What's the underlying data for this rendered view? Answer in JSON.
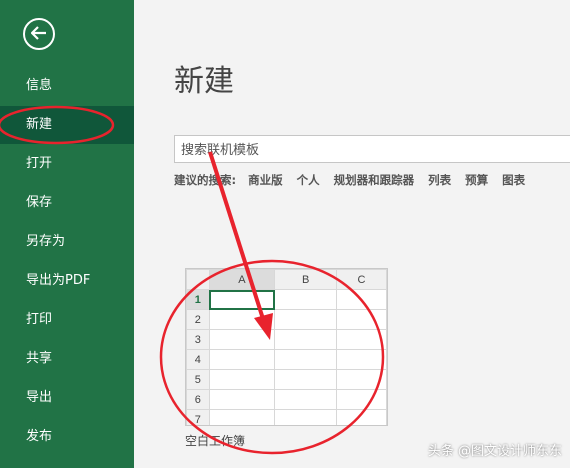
{
  "sidebar": {
    "back_icon": "back-arrow-icon",
    "items": [
      {
        "label": "信息"
      },
      {
        "label": "新建",
        "active": true
      },
      {
        "label": "打开"
      },
      {
        "label": "保存"
      },
      {
        "label": "另存为"
      },
      {
        "label": "导出为PDF"
      },
      {
        "label": "打印"
      },
      {
        "label": "共享"
      },
      {
        "label": "导出"
      },
      {
        "label": "发布"
      }
    ]
  },
  "main": {
    "title": "新建",
    "search": {
      "placeholder": "搜索联机模板"
    },
    "suggestions": {
      "label": "建议的搜索:",
      "items": [
        "商业版",
        "个人",
        "规划器和跟踪器",
        "列表",
        "预算",
        "图表"
      ]
    },
    "template": {
      "label": "空白工作簿",
      "columns": [
        "A",
        "B",
        "C"
      ],
      "rows": [
        "1",
        "2",
        "3",
        "4",
        "5",
        "6",
        "7"
      ]
    }
  },
  "watermark": "头条 @图文设计师东东",
  "colors": {
    "sidebar": "#217346",
    "active": "#10573a",
    "annotation": "#e8232d"
  }
}
